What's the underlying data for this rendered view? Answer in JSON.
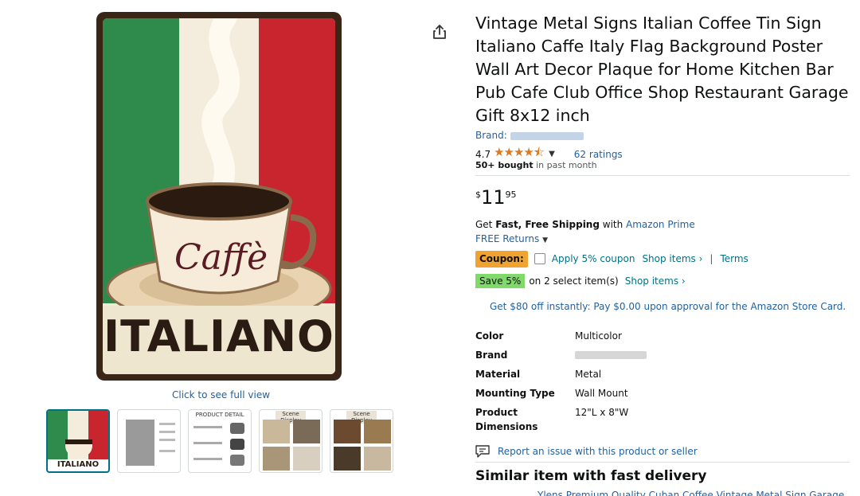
{
  "gallery": {
    "main_image_alt": "Italiano Caffe tin sign",
    "sign_word": "ITALIANO",
    "cup_word": "Caffè",
    "full_view_label": "Click to see full view",
    "thumbnails": [
      {
        "kind": "main",
        "label": "ITALIANO"
      },
      {
        "kind": "size-chart",
        "label": ""
      },
      {
        "kind": "detail",
        "label": "PRODUCT DETAIL"
      },
      {
        "kind": "scene",
        "label": "Scene Display"
      },
      {
        "kind": "scene",
        "label": "Scene Display"
      }
    ]
  },
  "product": {
    "title": "Vintage Metal Signs Italian Coffee Tin Sign Italiano Caffe Italy Flag Background Poster Wall Art Decor Plaque for Home Kitchen Bar Pub Cafe Club Office Shop Restaurant Garage Gift 8x12 inch",
    "brand_label": "Brand:",
    "rating": "4.7",
    "stars": "★★★★⯪",
    "ratings_count": "62 ratings",
    "bought_bold": "50+ bought",
    "bought_rest": "in past month",
    "price_symbol": "$",
    "price_whole": "11",
    "price_fraction": "95"
  },
  "shipping": {
    "prefix": "Get ",
    "bold": "Fast, Free Shipping",
    "middle": " with ",
    "link": "Amazon Prime",
    "returns": "FREE Returns"
  },
  "coupon": {
    "badge": "Coupon:",
    "apply": "Apply 5% coupon",
    "shop_items": "Shop items ›",
    "separator": "|",
    "terms": "Terms"
  },
  "save": {
    "badge": "Save 5%",
    "text": "on 2 select item(s)",
    "shop_items": "Shop items ›"
  },
  "card_offer": "Get $80 off instantly: Pay $0.00 upon approval for the Amazon Store Card.",
  "specs": [
    {
      "key": "Color",
      "value": "Multicolor"
    },
    {
      "key": "Brand",
      "value": ""
    },
    {
      "key": "Material",
      "value": "Metal"
    },
    {
      "key": "Mounting Type",
      "value": "Wall Mount"
    },
    {
      "key": "Product Dimensions",
      "value": "12\"L x 8\"W"
    }
  ],
  "report": "Report an issue with this product or seller",
  "similar": {
    "heading": "Similar item with fast delivery",
    "link": "Ylens Premium Quality Cuban Coffee Vintage Metal Sign Garage"
  },
  "icons": {
    "share": "share-icon",
    "report": "report-icon",
    "chevron": "chevron-down-icon"
  },
  "colors": {
    "link": "#2162a1",
    "teal": "#007185",
    "coupon": "#f0a330",
    "save": "#7fda69",
    "star": "#de7921"
  }
}
